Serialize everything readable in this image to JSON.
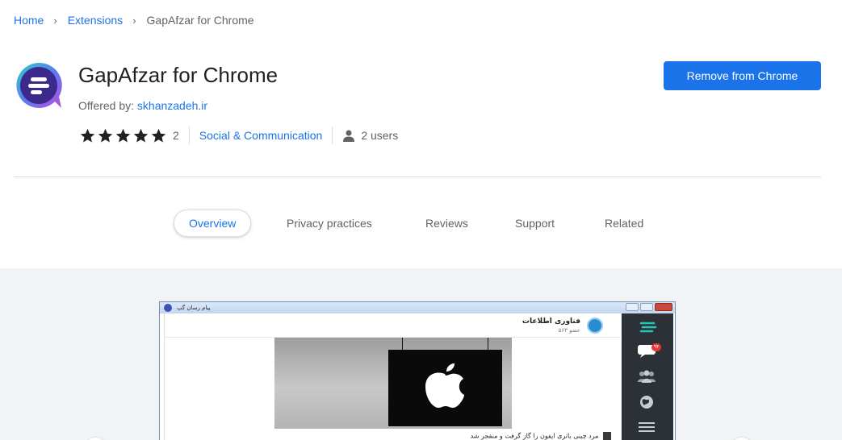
{
  "breadcrumb": {
    "home": "Home",
    "extensions": "Extensions",
    "current": "GapAfzar for Chrome",
    "separator": "›"
  },
  "extension": {
    "icon": "gapafzar-logo-icon",
    "title": "GapAfzar for Chrome",
    "offered_by_label": "Offered by:",
    "offered_by": "skhanzadeh.ir",
    "rating": 5,
    "rating_count": "2",
    "category": "Social & Communication",
    "users": "2 users"
  },
  "actions": {
    "remove_label": "Remove from Chrome"
  },
  "tabs": [
    {
      "label": "Overview",
      "active": true
    },
    {
      "label": "Privacy practices",
      "active": false
    },
    {
      "label": "Reviews",
      "active": false
    },
    {
      "label": "Support",
      "active": false
    },
    {
      "label": "Related",
      "active": false
    }
  ],
  "screenshot": {
    "window_title": "پیام رسان گپ",
    "channel_name": "فناوری اطلاعات",
    "channel_members": "۵۶۳ عضو",
    "badge_count": "۹۴",
    "post_caption": "مرد چینی باتری ایفون را گاز گرفت و منفجر شد"
  },
  "colors": {
    "accent": "#1a73e8",
    "text": "#202124",
    "muted": "#5f6368",
    "gallery_bg": "#f1f3f4"
  }
}
